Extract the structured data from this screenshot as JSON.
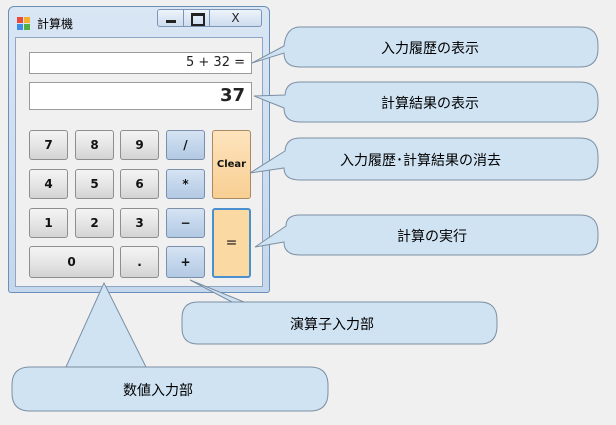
{
  "window": {
    "title": "計算機",
    "controls": {
      "minimize": "minimize",
      "maximize": "maximize",
      "close": "X"
    }
  },
  "display": {
    "history": "5 + 32 =",
    "result": "37"
  },
  "keypad": {
    "digits": [
      "7",
      "8",
      "9",
      "4",
      "5",
      "6",
      "1",
      "2",
      "3",
      "0",
      "."
    ],
    "operators": [
      "/",
      "*",
      "−",
      "+"
    ],
    "clear": "Clear",
    "equals": "="
  },
  "callouts": {
    "history_display": "入力履歴の表示",
    "result_display": "計算結果の表示",
    "clear_function": "入力履歴･計算結果の消去",
    "execute": "計算の実行",
    "operator_input": "演算子入力部",
    "number_input": "数値入力部"
  },
  "colors": {
    "callout_fill": "#cfe3f3",
    "callout_stroke": "#7d8fa3",
    "operator_button": "#c3d6ec",
    "clear_button": "#f8cf93",
    "equals_border": "#4a8fd0"
  }
}
